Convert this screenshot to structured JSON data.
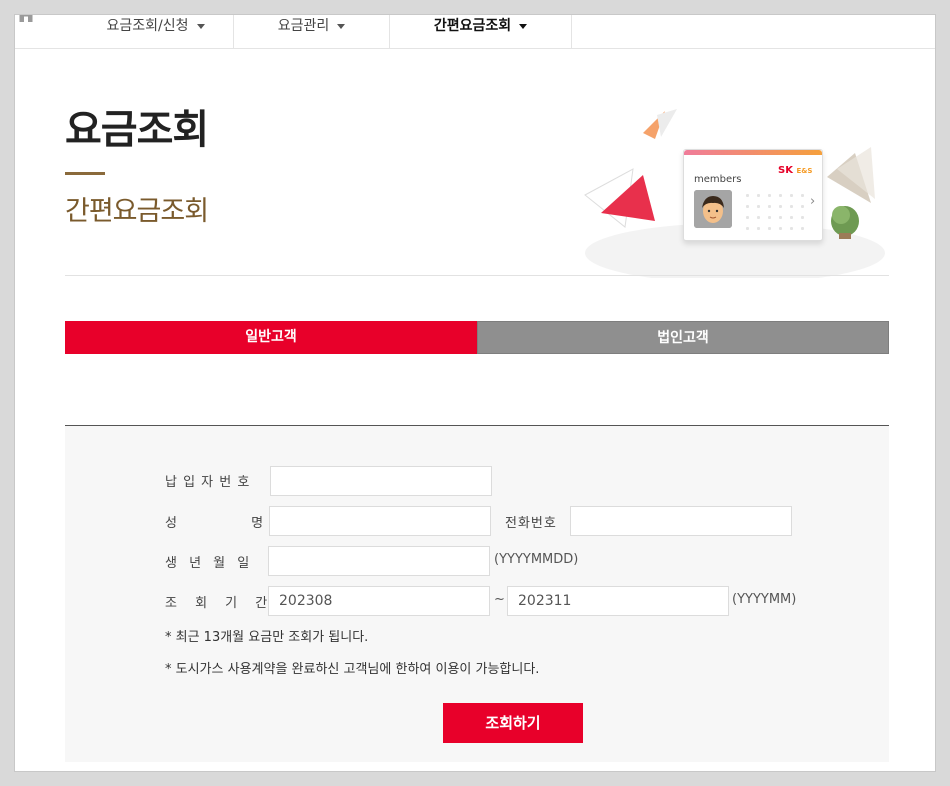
{
  "nav": {
    "home_icon": "home-icon",
    "items": [
      {
        "label": "요금조회/신청"
      },
      {
        "label": "요금관리"
      },
      {
        "label": "간편요금조회"
      }
    ],
    "active_index": 2
  },
  "header": {
    "title": "요금조회",
    "subtitle": "간편요금조회"
  },
  "illustration": {
    "card_text": "members",
    "logo_text": "SK",
    "logo_sub": "E&S"
  },
  "tabs": [
    {
      "label": "일반고객",
      "active": true
    },
    {
      "label": "법인고객",
      "active": false
    }
  ],
  "form": {
    "payer_number": {
      "label": "납 입 자 번 호",
      "value": ""
    },
    "name": {
      "label": "성 명",
      "value": ""
    },
    "phone": {
      "label": "전화번호",
      "value": ""
    },
    "birth": {
      "label": "생 년 월 일",
      "value": "",
      "hint": "(YYYYMMDD)"
    },
    "period": {
      "label": "조 회 기 간",
      "from": "202308",
      "separator": "~",
      "to": "202311",
      "hint": "(YYYYMM)"
    },
    "notes": [
      "* 최근 13개월 요금만 조회가 됩니다.",
      "* 도시가스 사용계약을 완료하신 고객님에 한하여 이용이 가능합니다."
    ],
    "submit_label": "조회하기"
  },
  "colors": {
    "accent": "#e8002a",
    "brown": "#7a5a2c",
    "tab_inactive": "#8f8f8f"
  }
}
